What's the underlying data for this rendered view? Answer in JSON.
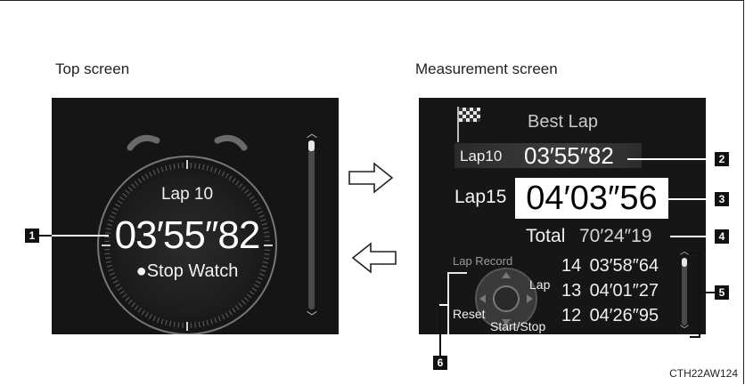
{
  "captions": {
    "top_screen": "Top screen",
    "measurement_screen": "Measurement screen",
    "doc_code": "CTH22AW124"
  },
  "top_screen": {
    "lap_label": "Lap 10",
    "lap_time": "03′55″82",
    "stopwatch_label": "●Stop Watch",
    "scroll_up_icon": "chevron-up-icon",
    "scroll_down_icon": "chevron-down-icon"
  },
  "measurement_screen": {
    "best_lap_label": "Best Lap",
    "best_lap": {
      "label": "Lap10",
      "time": "03′55″82"
    },
    "current_lap": {
      "label": "Lap15",
      "time": "04′03″56"
    },
    "total": {
      "label": "Total",
      "time": "70′24″19"
    },
    "lap_record_label": "Lap Record",
    "lap_records": [
      {
        "lap": "14",
        "time": "03′58″64"
      },
      {
        "lap": "13",
        "time": "04′01″27"
      },
      {
        "lap": "12",
        "time": "04′26″95"
      }
    ],
    "controls": {
      "lap": "Lap",
      "reset": "Reset",
      "start_stop": "Start/Stop"
    }
  },
  "callouts": [
    "1",
    "2",
    "3",
    "4",
    "5",
    "6"
  ],
  "colors": {
    "screen_bg": "#151515",
    "highlight_box": "#ffffff",
    "callout_bg": "#111111"
  }
}
